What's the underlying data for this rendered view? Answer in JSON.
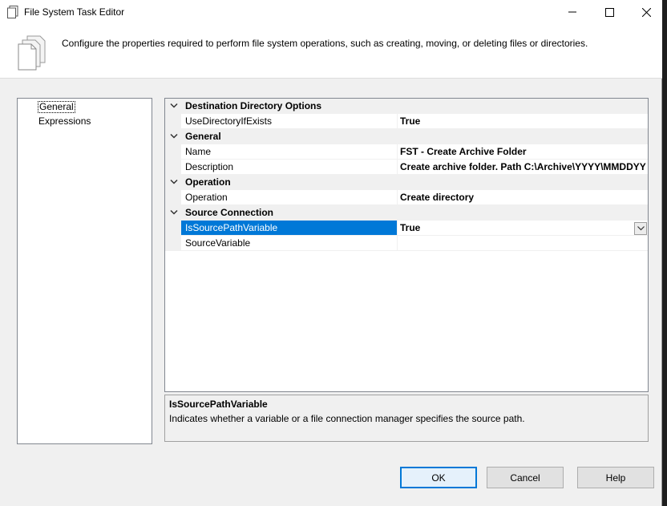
{
  "window": {
    "title": "File System Task Editor",
    "minimize_glyph": "—",
    "maximize_glyph": "☐",
    "close_glyph": "✕"
  },
  "header": {
    "description": "Configure the properties required to perform file system operations, such as creating, moving, or deleting files or directories.",
    "icon": "documents-icon"
  },
  "nav": {
    "items": [
      {
        "label": "General",
        "selected": true
      },
      {
        "label": "Expressions",
        "selected": false
      }
    ]
  },
  "grid": {
    "categories": [
      {
        "label": "Destination Directory Options",
        "properties": [
          {
            "name": "UseDirectoryIfExists",
            "value": "True"
          }
        ]
      },
      {
        "label": "General",
        "properties": [
          {
            "name": "Name",
            "value": "FST - Create Archive Folder"
          },
          {
            "name": "Description",
            "value": "Create archive folder.  Path C:\\Archive\\YYYY\\MMDDYY"
          }
        ]
      },
      {
        "label": "Operation",
        "properties": [
          {
            "name": "Operation",
            "value": "Create directory"
          }
        ]
      },
      {
        "label": "Source Connection",
        "properties": [
          {
            "name": "IsSourcePathVariable",
            "value": "True",
            "selected": true
          },
          {
            "name": "SourceVariable",
            "value": ""
          }
        ]
      }
    ]
  },
  "description_pane": {
    "title": "IsSourcePathVariable",
    "text": "Indicates whether a variable or a file connection manager specifies the source path."
  },
  "buttons": {
    "ok": "OK",
    "cancel": "Cancel",
    "help": "Help"
  },
  "colors": {
    "selection": "#0078d7",
    "default_button_border": "#0078d7"
  }
}
